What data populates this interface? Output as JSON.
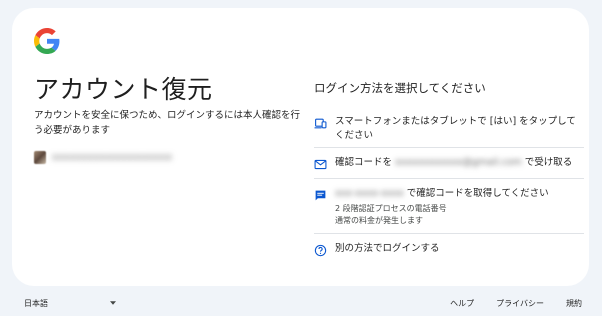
{
  "header": {
    "logo": "google-g-logo",
    "title": "アカウント復元",
    "subtitle": "アカウントを安全に保つため、ログインするには本人確認を行う必要があります"
  },
  "account": {
    "email_redacted": "xxxxxxxxxxxxxxxxxxxx"
  },
  "methods": {
    "heading": "ログイン方法を選択してください",
    "options": [
      {
        "icon": "phone-tablet-icon",
        "label": "スマートフォンまたはタブレットで [はい] をタップしてください"
      },
      {
        "icon": "mail-icon",
        "prefix": "確認コードを",
        "redacted": "xxxxxxxxxxxx@gmail.com",
        "suffix": "で受け取る"
      },
      {
        "icon": "sms-icon",
        "redacted": "xxx-xxxx-xxxx",
        "suffix": "で確認コードを取得してください",
        "sub1": "2 段階認証プロセスの電話番号",
        "sub2": "通常の料金が発生します"
      },
      {
        "icon": "help-icon",
        "label": "別の方法でログインする"
      }
    ]
  },
  "footer": {
    "language": "日本語",
    "help": "ヘルプ",
    "privacy": "プライバシー",
    "terms": "規約"
  },
  "colors": {
    "accent": "#0b57d0",
    "background": "#f0f4f9",
    "card": "#ffffff"
  }
}
